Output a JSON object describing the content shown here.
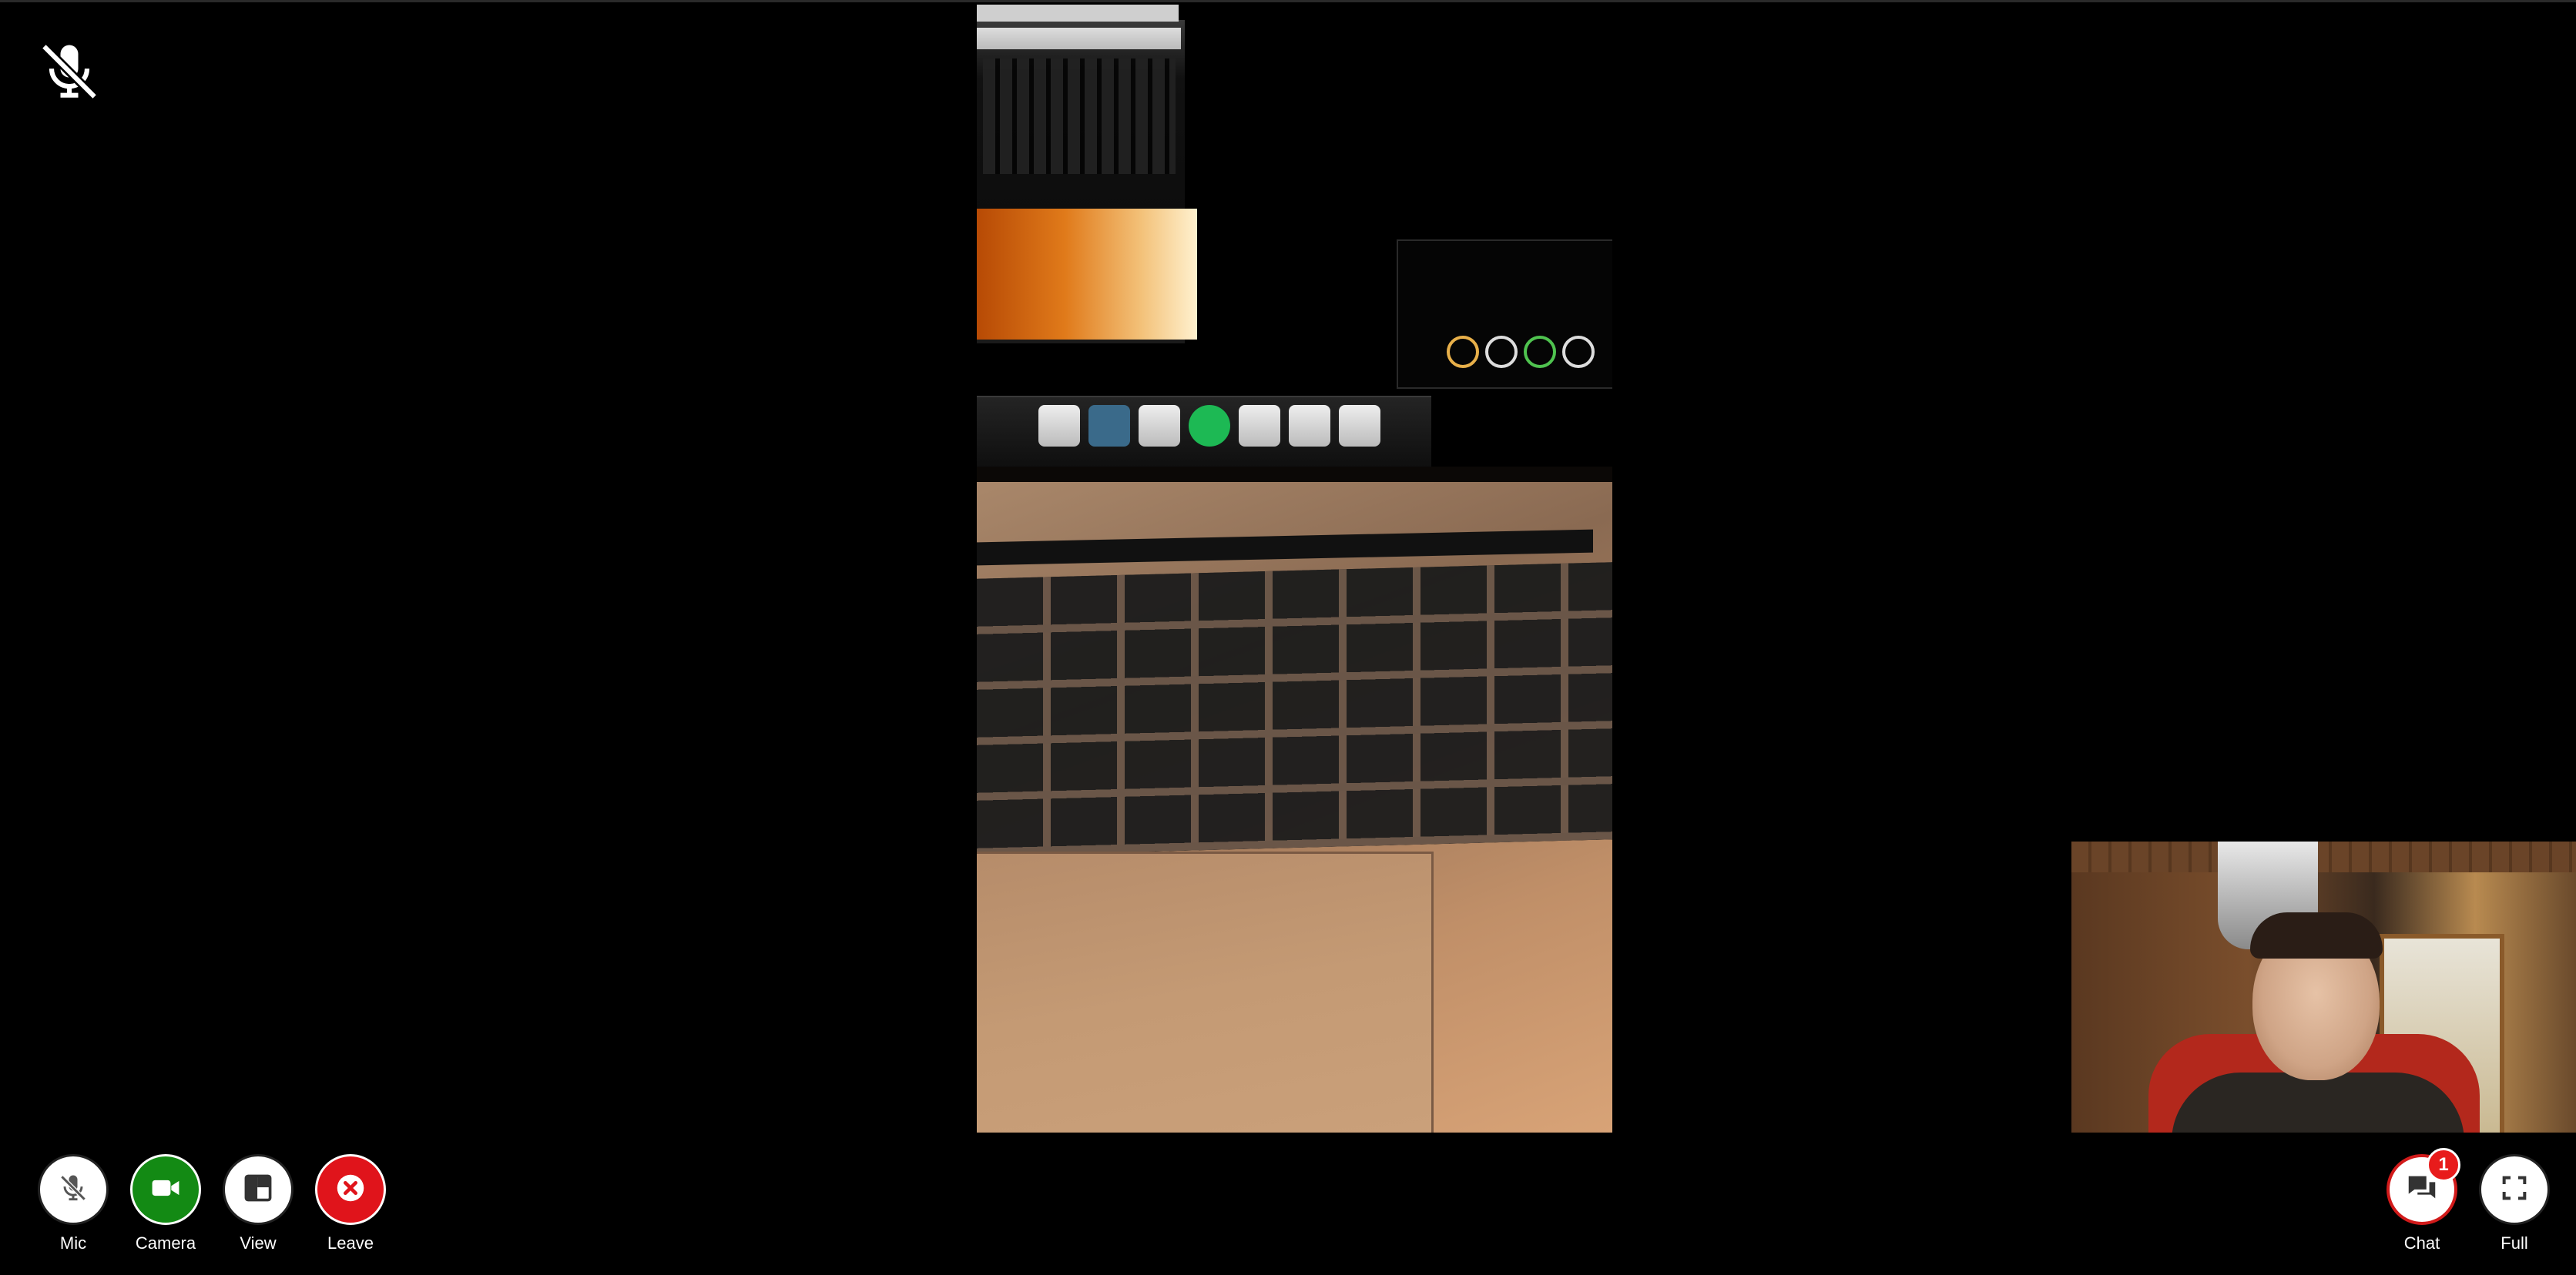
{
  "controls": {
    "mic": {
      "label": "Mic",
      "state": "muted"
    },
    "camera": {
      "label": "Camera",
      "state": "on"
    },
    "view": {
      "label": "View"
    },
    "leave": {
      "label": "Leave"
    },
    "chat": {
      "label": "Chat",
      "unread_count": "1"
    },
    "full": {
      "label": "Full"
    }
  },
  "indicators": {
    "top_left_icon": "mic-muted-icon"
  },
  "icons": {
    "mic": "mic-off-icon",
    "camera": "video-camera-icon",
    "view": "layout-icon",
    "leave": "close-circle-icon",
    "chat": "chat-bubbles-icon",
    "full": "fullscreen-icon"
  },
  "colors": {
    "background": "#000000",
    "camera_on": "#138a14",
    "leave": "#e0141b",
    "badge": "#e81b1b",
    "chat_ring": "#d11a1a"
  }
}
